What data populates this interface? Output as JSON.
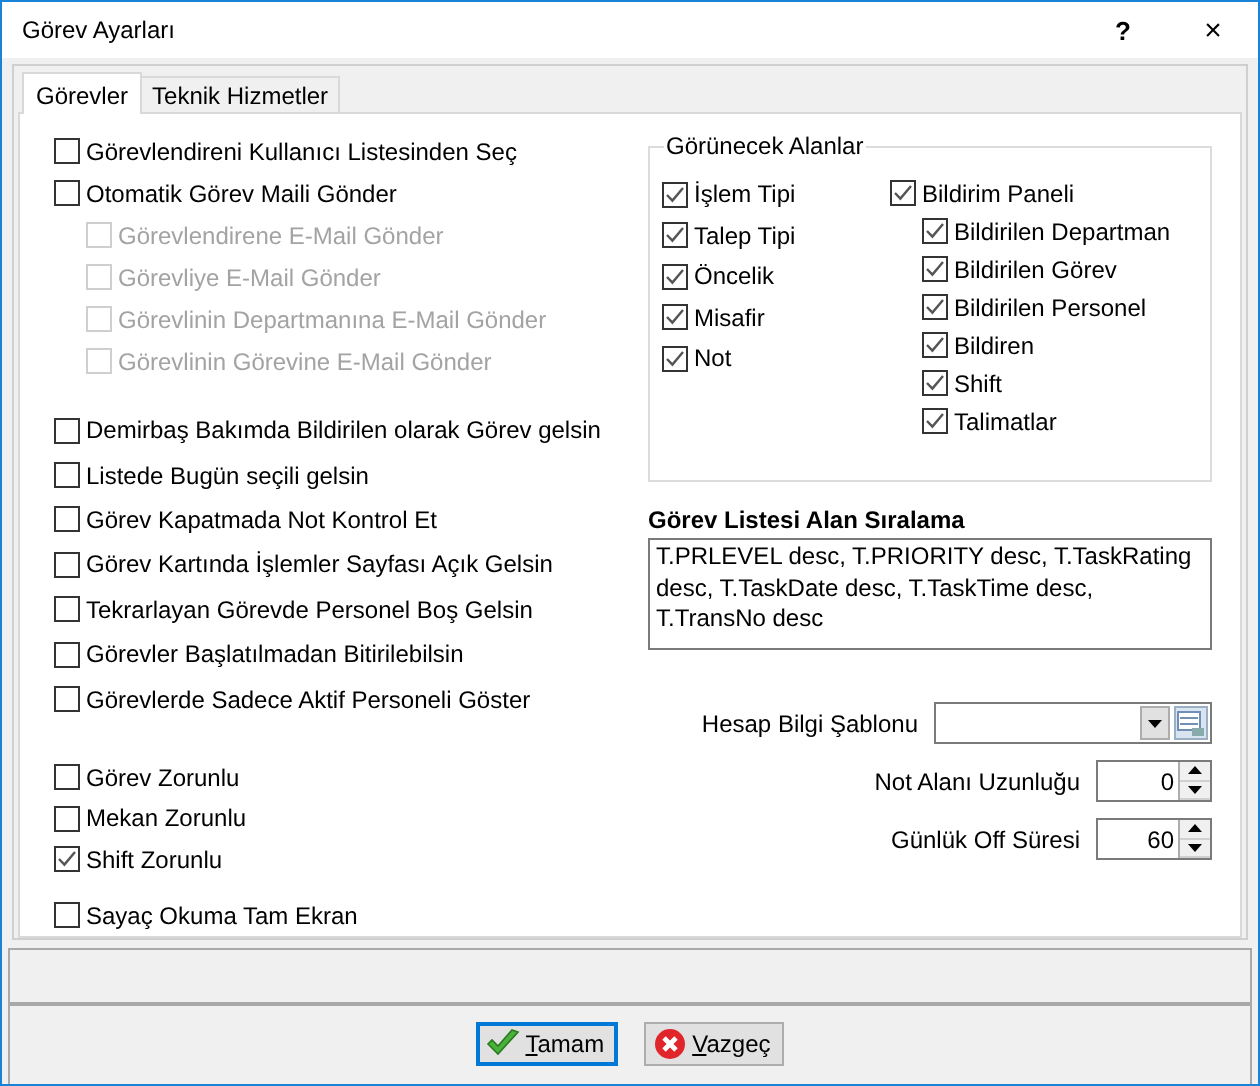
{
  "window": {
    "title": "Görev Ayarları",
    "help": "?",
    "close": "×"
  },
  "tabs": [
    {
      "label": "Görevler",
      "selected": true
    },
    {
      "label": "Teknik Hizmetler",
      "selected": false
    }
  ],
  "options": [
    {
      "items": [
        {
          "label": "Görevlendireni Kullanıcı Listesinden Seç",
          "checked": false,
          "disabled": false
        },
        {
          "label": "Otomatik Görev Maili Gönder",
          "checked": false,
          "disabled": false,
          "children": [
            {
              "label": "Görevlendirene E-Mail Gönder",
              "checked": false,
              "disabled": true
            },
            {
              "label": "Görevliye E-Mail Gönder",
              "checked": false,
              "disabled": true
            },
            {
              "label": "Görevlinin Departmanına E-Mail Gönder",
              "checked": false,
              "disabled": true
            },
            {
              "label": "Görevlinin Görevine E-Mail Gönder",
              "checked": false,
              "disabled": true
            }
          ]
        }
      ]
    },
    {
      "items": [
        {
          "label": "Demirbaş Bakımda Bildirilen olarak Görev gelsin",
          "checked": false,
          "disabled": false
        },
        {
          "label": "Listede Bugün seçili gelsin",
          "checked": false,
          "disabled": false
        },
        {
          "label": "Görev Kapatmada Not Kontrol Et",
          "checked": false,
          "disabled": false
        },
        {
          "label": "Görev Kartında İşlemler Sayfası Açık Gelsin",
          "checked": false,
          "disabled": false
        },
        {
          "label": "Tekrarlayan Görevde Personel Boş Gelsin",
          "checked": false,
          "disabled": false
        },
        {
          "label": "Görevler Başlatılmadan Bitirilebilsin",
          "checked": false,
          "disabled": false
        },
        {
          "label": "Görevlerde Sadece Aktif Personeli Göster",
          "checked": false,
          "disabled": false
        }
      ]
    },
    {
      "items": [
        {
          "label": "Görev Zorunlu",
          "checked": false,
          "disabled": false
        },
        {
          "label": "Mekan Zorunlu",
          "checked": false,
          "disabled": false
        },
        {
          "label": "Shift Zorunlu",
          "checked": true,
          "disabled": false
        }
      ]
    },
    {
      "items": [
        {
          "label": "Sayaç Okuma Tam Ekran",
          "checked": false,
          "disabled": false
        }
      ]
    }
  ],
  "visible_fields": {
    "title": "Görünecek Alanlar",
    "columns": [
      [
        {
          "label": "İşlem Tipi",
          "checked": true,
          "disabled": false
        },
        {
          "label": "Talep Tipi",
          "checked": true,
          "disabled": false
        },
        {
          "label": "Öncelik",
          "checked": true,
          "disabled": false
        },
        {
          "label": "Misafir",
          "checked": true,
          "disabled": false
        },
        {
          "label": "Not",
          "checked": true,
          "disabled": false
        }
      ],
      [
        {
          "label": "Bildirim Paneli",
          "checked": true,
          "disabled": false,
          "children": [
            {
              "label": "Bildirilen Departman",
              "checked": true,
              "disabled": false
            },
            {
              "label": "Bildirilen Görev",
              "checked": true,
              "disabled": false
            },
            {
              "label": "Bildirilen Personel",
              "checked": true,
              "disabled": false
            },
            {
              "label": "Bildiren",
              "checked": true,
              "disabled": false
            },
            {
              "label": "Shift",
              "checked": true,
              "disabled": false
            },
            {
              "label": "Talimatlar",
              "checked": true,
              "disabled": false
            }
          ]
        }
      ]
    ]
  },
  "sort": {
    "title": "Görev Listesi Alan Sıralama",
    "value": "T.PRLEVEL desc, T.PRIORITY desc, T.TaskRating desc, T.TaskDate desc, T.TaskTime desc, T.TransNo desc"
  },
  "fields": [
    {
      "kind": "combo",
      "label": "Hesap Bilgi Şablonu"
    },
    {
      "kind": "spin",
      "label": "Not Alanı Uzunluğu",
      "value": "0"
    },
    {
      "kind": "spin",
      "label": "Günlük Off Süresi",
      "value": "60"
    }
  ],
  "buttons": [
    {
      "label": "Tamam",
      "kind": "ok",
      "focused": true
    },
    {
      "label": "Vazgeç",
      "kind": "cancel",
      "focused": false
    }
  ]
}
